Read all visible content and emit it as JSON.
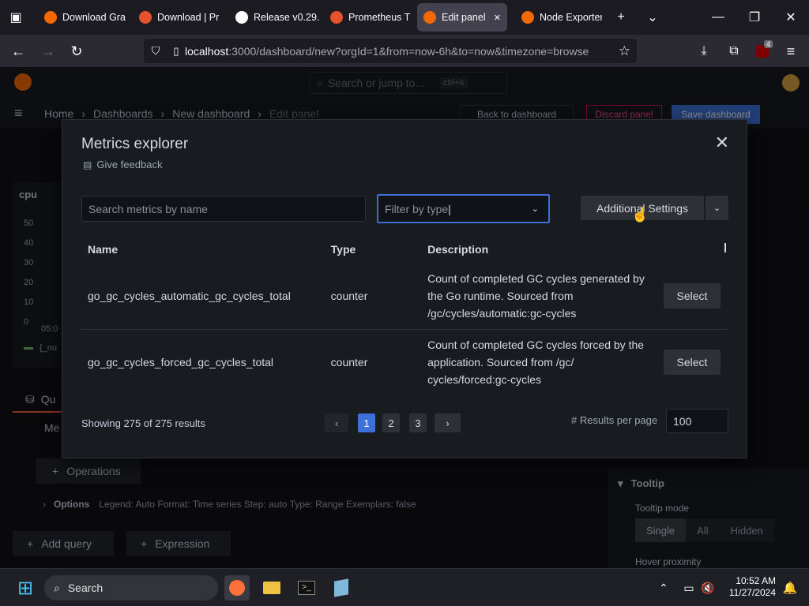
{
  "browser": {
    "tabs": [
      {
        "label": "Download Gra",
        "icon": "grafana-icon",
        "color": "#f46800"
      },
      {
        "label": "Download | Pr",
        "icon": "prometheus-icon",
        "color": "#e6522c"
      },
      {
        "label": "Release v0.29.",
        "icon": "github-icon",
        "color": "#ffffff"
      },
      {
        "label": "Prometheus T",
        "icon": "prometheus-icon",
        "color": "#e6522c"
      },
      {
        "label": "Edit panel -",
        "icon": "grafana-icon",
        "color": "#f46800"
      },
      {
        "label": "Node Exporter",
        "icon": "grafana-icon",
        "color": "#f46800"
      }
    ],
    "url_host": "localhost",
    "url_rest": ":3000/dashboard/new?orgId=1&from=now-6h&to=now&timezone=browse",
    "extension_badge": "4"
  },
  "grafana": {
    "search_placeholder": "Search or jump to...",
    "search_shortcut": "ctrl+k",
    "breadcrumb": [
      "Home",
      "Dashboards",
      "New dashboard",
      "Edit panel"
    ],
    "back_label": "Back to dashboard",
    "discard_label": "Discard panel",
    "save_label": "Save dashboard",
    "panel_title": "cpu",
    "y_ticks": [
      "50",
      "40",
      "30",
      "20",
      "10",
      "0"
    ],
    "x_tick": "05:0",
    "legend": "{_nu",
    "query_tab": "Qu",
    "metric_label": "Me",
    "operations_label": "Operations",
    "options_label": "Options",
    "options_summary": "Legend: Auto   Format: Time series   Step: auto   Type: Range   Exemplars: false",
    "add_query_label": "Add query",
    "expression_label": "Expression",
    "tooltip_section": "Tooltip",
    "tooltip_mode_label": "Tooltip mode",
    "tooltip_modes": [
      "Single",
      "All",
      "Hidden"
    ],
    "hover_label": "Hover proximity"
  },
  "modal": {
    "title": "Metrics explorer",
    "feedback": "Give feedback",
    "search_placeholder": "Search metrics by name",
    "filter_value": "Filter by type",
    "additional_settings": "Additional Settings",
    "columns": [
      "Name",
      "Type",
      "Description"
    ],
    "rows": [
      {
        "name": "go_gc_cycles_automatic_gc_cycles_total",
        "type": "counter",
        "description": "Count of completed GC cycles generated by the Go runtime. Sourced from /gc/cycles/automatic:gc-cycles",
        "action": "Select"
      },
      {
        "name": "go_gc_cycles_forced_gc_cycles_total",
        "type": "counter",
        "description": "Count of completed GC cycles forced by the application. Sourced from /gc/ cycles/forced:gc-cycles",
        "action": "Select"
      }
    ],
    "showing": "Showing 275 of 275 results",
    "pages": [
      "1",
      "2",
      "3"
    ],
    "current_page": "1",
    "per_page_label": "# Results per page",
    "per_page_value": "100"
  },
  "taskbar": {
    "search_label": "Search",
    "time": "10:52 AM",
    "date": "11/27/2024"
  }
}
